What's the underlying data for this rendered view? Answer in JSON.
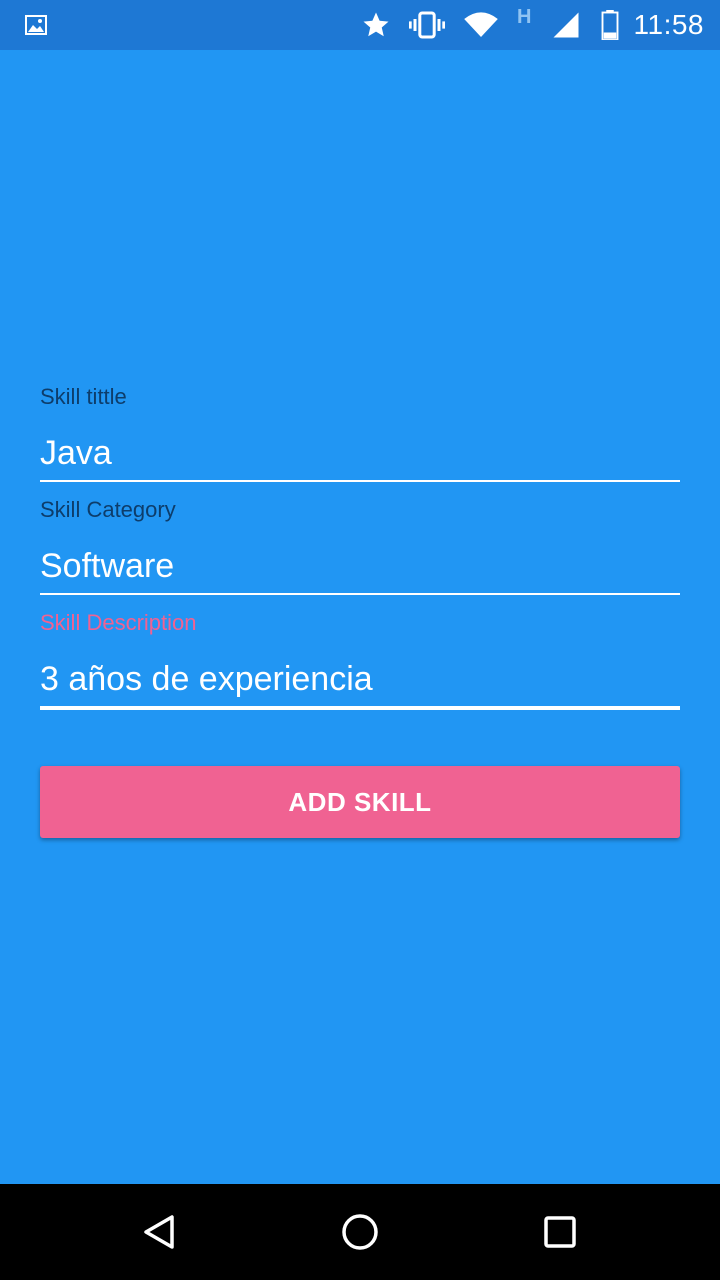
{
  "status_bar": {
    "time": "11:58",
    "network_type": "H",
    "icons": [
      "image-notification-icon",
      "star-icon",
      "vibrate-icon",
      "wifi-icon",
      "network-type-icon",
      "signal-icon",
      "battery-icon"
    ]
  },
  "form": {
    "title_field": {
      "label": "Skill tittle",
      "value": "Java"
    },
    "category_field": {
      "label": "Skill Category",
      "value": "Software"
    },
    "description_field": {
      "label": "Skill Description",
      "value": "3 años de experiencia",
      "focused": true
    },
    "submit_label": "ADD SKILL"
  },
  "nav_bar": {
    "icons": [
      "back-icon",
      "home-icon",
      "recents-icon"
    ]
  },
  "colors": {
    "background": "#2196F3",
    "status_bar": "#1E78D4",
    "accent": "#F06292",
    "label": "#0d3d6b",
    "text": "#ffffff"
  }
}
